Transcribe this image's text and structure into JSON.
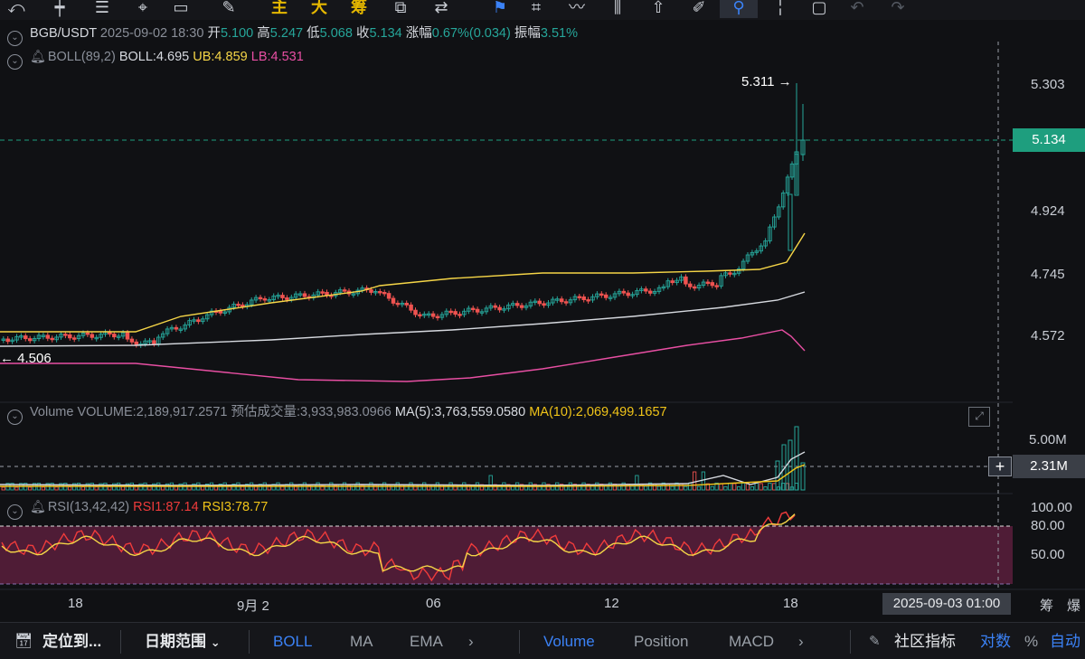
{
  "toolbar": {
    "tools": [
      "undo-icon",
      "line-tool-icon",
      "list-tool-icon",
      "box-icon",
      "cursor-icon",
      "note-icon",
      "gear-icon",
      "add-icon",
      "trend-line-icon",
      "draw-icon",
      "candle-icon",
      "export-icon",
      "edit-icon",
      "fav-icon",
      "magnet-icon",
      "pin-icon",
      "delete-icon",
      "redo-icon",
      "redo2-icon"
    ],
    "sig_labels": [
      "主",
      "大",
      "筹"
    ]
  },
  "header": {
    "symbol": "BGB/USDT",
    "datetime": "2025-09-02 18:30",
    "open_label": "开",
    "open": "5.100",
    "high_label": "高",
    "high": "5.247",
    "low_label": "低",
    "low": "5.068",
    "close_label": "收",
    "close": "5.134",
    "change_label": "涨幅",
    "change": "0.67%(0.034)",
    "amp_label": "振幅",
    "amp": "3.51%"
  },
  "boll": {
    "name": "BOLL(89,2)",
    "mid": "BOLL:4.695",
    "ub": "UB:4.859",
    "lb": "LB:4.531"
  },
  "volume": {
    "name": "Volume",
    "value": "VOLUME:2,189,917.2571",
    "estimate": "预估成交量:3,933,983.0966",
    "ma5": "MA(5):3,763,559.0580",
    "ma10": "MA(10):2,069,499.1657"
  },
  "rsi": {
    "name": "RSI(13,42,42)",
    "rsi1": "RSI1:87.14",
    "rsi3": "RSI3:78.77"
  },
  "price_axis": [
    "5.303",
    "4.924",
    "4.745",
    "4.572"
  ],
  "current_price": "5.134",
  "high_marker": "5.311",
  "low_marker": "4.506",
  "volume_axis": [
    "5.00M"
  ],
  "volume_cursor": "2.31M",
  "rsi_axis": [
    "100.00",
    "80.00",
    "50.00"
  ],
  "time_axis": [
    "18",
    "9月 2",
    "06",
    "12",
    "18"
  ],
  "cursor_time": "2025-09-03 01:00",
  "right_tools": [
    "筹",
    "爆"
  ],
  "colors": {
    "up": "#26a69a",
    "down": "#ef5350",
    "accent": "#3b82f6",
    "price_tag": "#1e9e7e"
  },
  "bottom_bar": {
    "locate": "定位到...",
    "date_range": "日期范围",
    "main_indicators": [
      "BOLL",
      "MA",
      "EMA"
    ],
    "sub_indicators": [
      "Volume",
      "Position",
      "MACD"
    ],
    "community": "社区指标",
    "log": "对数",
    "percent": "%",
    "auto": "自动"
  }
}
